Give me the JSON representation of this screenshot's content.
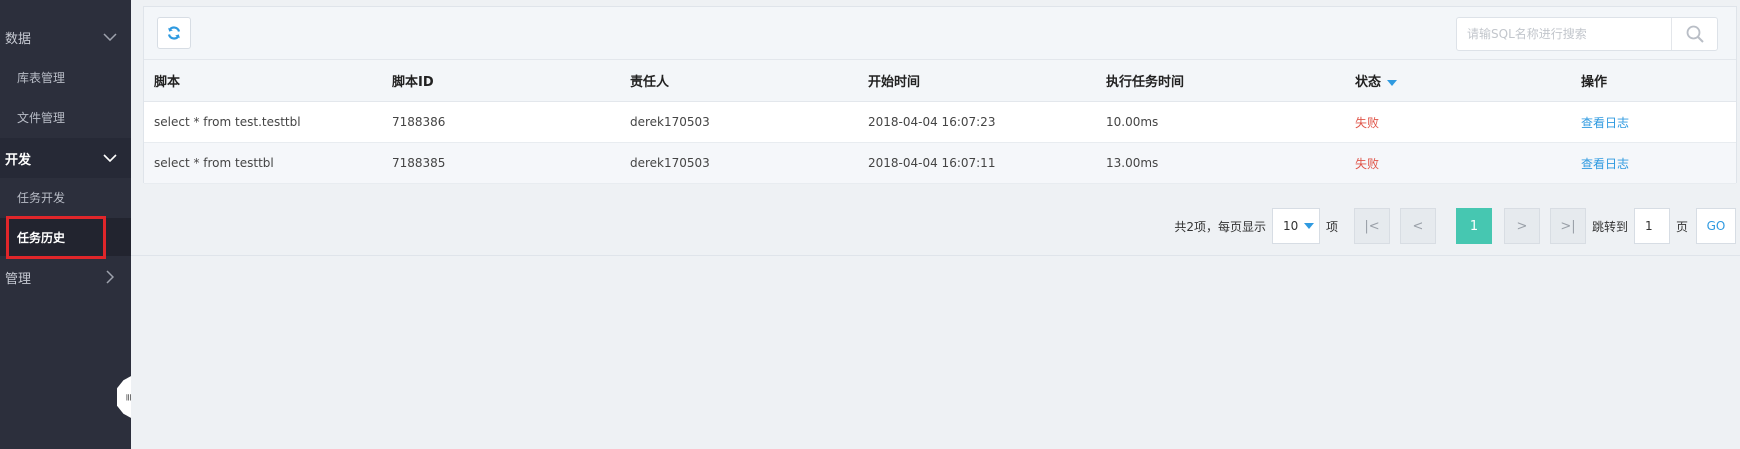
{
  "sidebar": {
    "groups": [
      {
        "label": "数据",
        "items": [
          "库表管理",
          "文件管理"
        ]
      },
      {
        "label": "开发",
        "items": [
          "任务开发",
          "任务历史"
        ]
      },
      {
        "label": "管理"
      }
    ],
    "collapse_glyph": "≡"
  },
  "toolbar": {
    "search_placeholder": "请输SQL名称进行搜索"
  },
  "table": {
    "columns": [
      "脚本",
      "脚本ID",
      "责任人",
      "开始时间",
      "执行任务时间",
      "状态",
      "操作"
    ],
    "rows": [
      {
        "script": "select * from test.testtbl",
        "id": "7188386",
        "owner": "derek170503",
        "start": "2018-04-04 16:07:23",
        "duration": "10.00ms",
        "status": "失败",
        "action": "查看日志"
      },
      {
        "script": "select * from testtbl",
        "id": "7188385",
        "owner": "derek170503",
        "start": "2018-04-04 16:07:11",
        "duration": "13.00ms",
        "status": "失败",
        "action": "查看日志"
      }
    ]
  },
  "pagination": {
    "total_prefix": "共2项，每页显示",
    "page_size": "10",
    "item_unit": "项",
    "first": "|<",
    "prev": "<",
    "current": "1",
    "next": ">",
    "last": ">|",
    "jump_label": "跳转到",
    "jump_value": "1",
    "page_unit": "页",
    "go": "GO"
  },
  "colors": {
    "sidebar_bg": "#2c2f3c",
    "accent": "#2f9ae0",
    "fail": "#e0564a",
    "active_page": "#46c7b1",
    "highlight_box": "#e0262a"
  }
}
